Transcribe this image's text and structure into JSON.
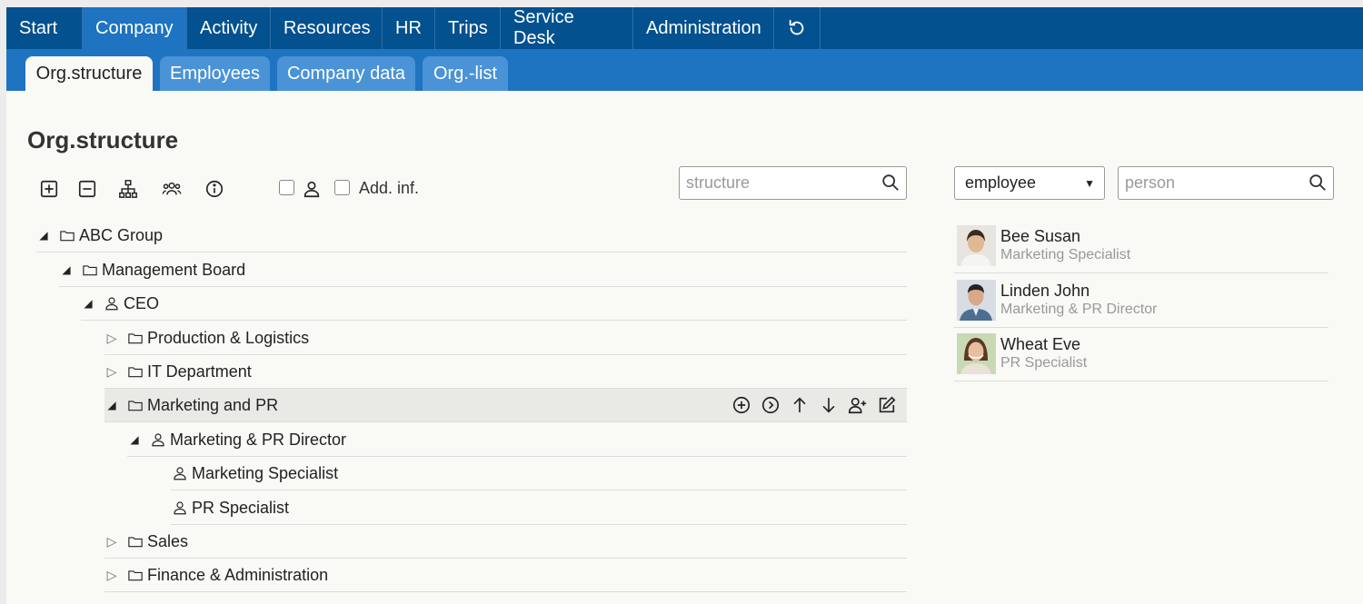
{
  "topnav": {
    "items": [
      "Start",
      "Company",
      "Activity",
      "Resources",
      "HR",
      "Trips",
      "Service Desk",
      "Administration"
    ],
    "active": "Company",
    "refresh_icon": "refresh-icon"
  },
  "subnav": {
    "tabs": [
      "Org.structure",
      "Employees",
      "Company data",
      "Org.-list"
    ],
    "active": "Org.structure"
  },
  "page": {
    "title": "Org.structure"
  },
  "toolbar": {
    "icons": [
      "expand-all-icon",
      "collapse-all-icon",
      "hierarchy-icon",
      "group-icon",
      "info-icon"
    ],
    "person_checkbox_checked": false,
    "addinf_checkbox_checked": false,
    "addinf_label": "Add. inf."
  },
  "structure_search": {
    "value": "",
    "placeholder": "structure"
  },
  "employee_filter": {
    "selected": "employee"
  },
  "person_search": {
    "value": "",
    "placeholder": "person"
  },
  "tree": [
    {
      "label": "ABC Group",
      "type": "folder",
      "state": "expanded"
    },
    {
      "label": "Management Board",
      "type": "folder",
      "state": "expanded"
    },
    {
      "label": "CEO",
      "type": "person",
      "state": "expanded"
    },
    {
      "label": "Production & Logistics",
      "type": "folder",
      "state": "collapsed"
    },
    {
      "label": "IT Department",
      "type": "folder",
      "state": "collapsed"
    },
    {
      "label": "Marketing and PR",
      "type": "folder",
      "state": "expanded",
      "highlighted": true
    },
    {
      "label": "Marketing & PR Director",
      "type": "person",
      "state": "expanded"
    },
    {
      "label": "Marketing Specialist",
      "type": "person",
      "state": "leaf"
    },
    {
      "label": "PR Specialist",
      "type": "person",
      "state": "leaf"
    },
    {
      "label": "Sales",
      "type": "folder",
      "state": "collapsed"
    },
    {
      "label": "Finance & Administration",
      "type": "folder",
      "state": "collapsed"
    }
  ],
  "row_actions": [
    "add-circle-icon",
    "next-circle-icon",
    "arrow-up-icon",
    "arrow-down-icon",
    "add-person-icon",
    "edit-icon"
  ],
  "employees": [
    {
      "name": "Bee Susan",
      "role": "Marketing Specialist"
    },
    {
      "name": "Linden John",
      "role": "Marketing & PR Director"
    },
    {
      "name": "Wheat Eve",
      "role": "PR Specialist"
    }
  ]
}
